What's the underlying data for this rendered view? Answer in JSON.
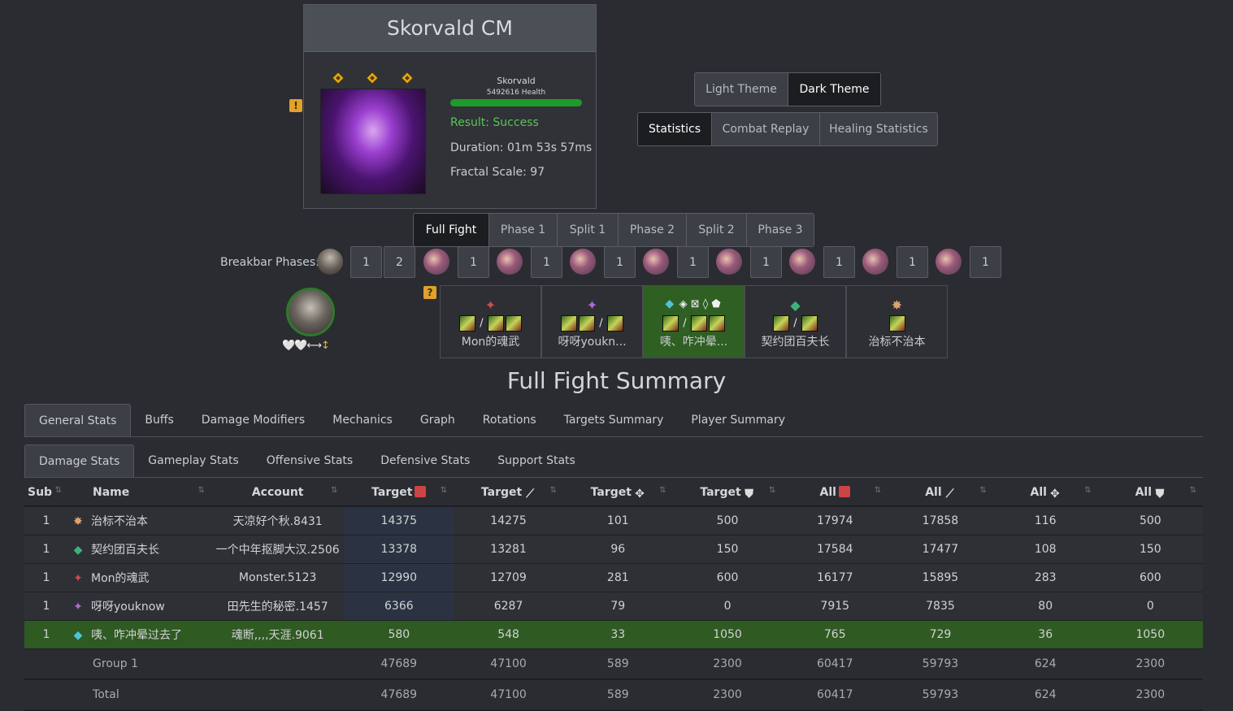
{
  "encounter": {
    "title": "Skorvald CM",
    "boss_name": "Skorvald",
    "boss_health": "5492616 Health",
    "health_fraction": 1.0,
    "result": "Result: Success",
    "duration": "Duration: 01m 53s 57ms",
    "fractal_scale": "Fractal Scale: 97",
    "cm_icon_count": 3,
    "warning_glyph": "!"
  },
  "theme_buttons": [
    "Light Theme",
    "Dark Theme"
  ],
  "theme_active": "Dark Theme",
  "view_buttons": [
    "Statistics",
    "Combat Replay",
    "Healing Statistics"
  ],
  "view_active": "Statistics",
  "phases": [
    "Full Fight",
    "Phase 1",
    "Split 1",
    "Phase 2",
    "Split 2",
    "Phase 3"
  ],
  "phase_active": "Full Fight",
  "breakbar": {
    "label": "Breakbar Phases:",
    "values": [
      "1",
      "2",
      "1",
      "1",
      "1",
      "1",
      "1",
      "1",
      "1",
      "1"
    ]
  },
  "target_status_icons": "🤍🤍⟷",
  "question_glyph": "?",
  "players": [
    {
      "name": "Mon的魂武",
      "prof_icon": "✦",
      "prof_color": "#d04a4a",
      "utilities": ""
    },
    {
      "name": "呀呀youkn...",
      "prof_icon": "✦",
      "prof_color": "#b06ad8",
      "utilities": ""
    },
    {
      "name": "咦、咋冲晕...",
      "prof_icon": "◆",
      "prof_color": "#4ec3d6",
      "utilities": "◈ ⊠ ◊ ⬟"
    },
    {
      "name": "契约团百夫长",
      "prof_icon": "◆",
      "prof_color": "#3bb378",
      "utilities": ""
    },
    {
      "name": "治标不治本",
      "prof_icon": "✸",
      "prof_color": "#e0a070",
      "utilities": ""
    }
  ],
  "summary_title": "Full Fight Summary",
  "main_tabs": [
    "General Stats",
    "Buffs",
    "Damage Modifiers",
    "Mechanics",
    "Graph",
    "Rotations",
    "Targets Summary",
    "Player Summary"
  ],
  "main_tab_active": "General Stats",
  "sub_tabs": [
    "Damage Stats",
    "Gameplay Stats",
    "Offensive Stats",
    "Defensive Stats",
    "Support Stats"
  ],
  "sub_tab_active": "Damage Stats",
  "table": {
    "headers": [
      "Sub",
      "Name",
      "Account",
      "Target",
      "Target",
      "Target",
      "Target",
      "All",
      "All",
      "All",
      "All"
    ],
    "header_icons": [
      "",
      "",
      "",
      "burst-icon",
      "power-icon",
      "condition-icon",
      "breakbar-icon",
      "burst-icon",
      "power-icon",
      "condition-icon",
      "breakbar-icon"
    ],
    "rows": [
      {
        "sub": "1",
        "prof_icon": "✸",
        "prof_color": "#e0a070",
        "name": "治标不治本",
        "account": "天凉好个秋.8431",
        "values": [
          "14375",
          "14275",
          "101",
          "500",
          "17974",
          "17858",
          "116",
          "500"
        ],
        "highlight": false
      },
      {
        "sub": "1",
        "prof_icon": "◆",
        "prof_color": "#3bb378",
        "name": "契约团百夫长",
        "account": "一个中年抠脚大汉.2506",
        "values": [
          "13378",
          "13281",
          "96",
          "150",
          "17584",
          "17477",
          "108",
          "150"
        ],
        "highlight": false
      },
      {
        "sub": "1",
        "prof_icon": "✦",
        "prof_color": "#d04a4a",
        "name": "Mon的魂武",
        "account": "Monster.5123",
        "values": [
          "12990",
          "12709",
          "281",
          "600",
          "16177",
          "15895",
          "283",
          "600"
        ],
        "highlight": false
      },
      {
        "sub": "1",
        "prof_icon": "✦",
        "prof_color": "#b06ad8",
        "name": "呀呀youknow",
        "account": "田先生的秘密.1457",
        "values": [
          "6366",
          "6287",
          "79",
          "0",
          "7915",
          "7835",
          "80",
          "0"
        ],
        "highlight": false
      },
      {
        "sub": "1",
        "prof_icon": "◆",
        "prof_color": "#4ec3d6",
        "name": "咦、咋冲晕过去了",
        "account": "魂断,,,,天涯.9061",
        "values": [
          "580",
          "548",
          "33",
          "1050",
          "765",
          "729",
          "36",
          "1050"
        ],
        "highlight": true
      }
    ],
    "footer": [
      {
        "label": "Group 1",
        "values": [
          "47689",
          "47100",
          "589",
          "2300",
          "60417",
          "59793",
          "624",
          "2300"
        ]
      },
      {
        "label": "Total",
        "values": [
          "47689",
          "47100",
          "589",
          "2300",
          "60417",
          "59793",
          "624",
          "2300"
        ]
      }
    ]
  }
}
